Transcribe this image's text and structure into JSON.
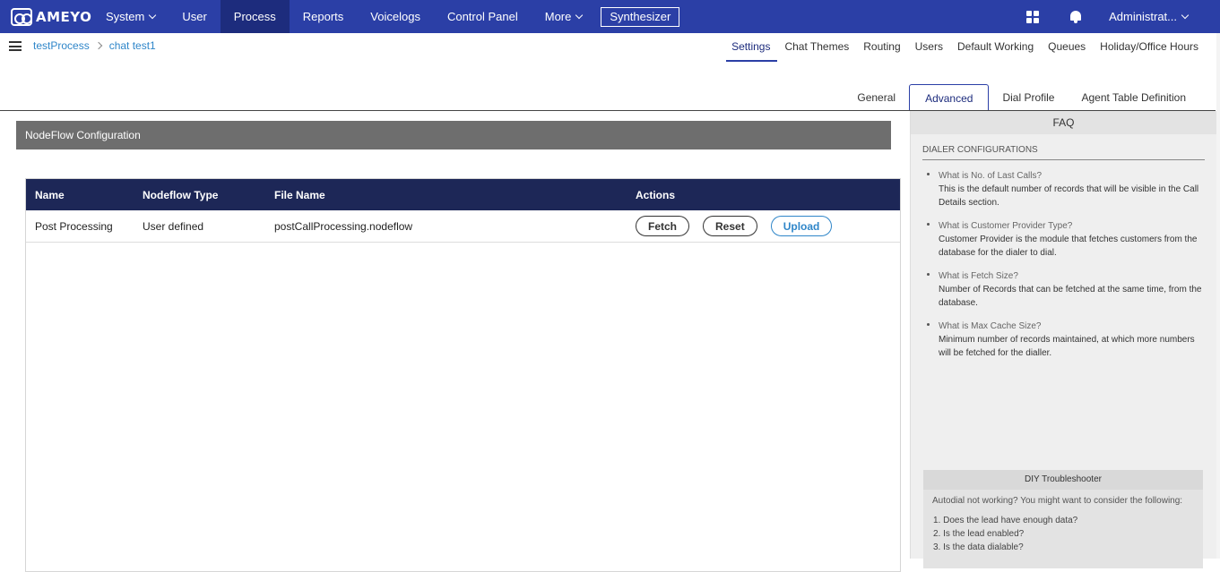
{
  "brand": {
    "name": "AMEYO"
  },
  "nav": {
    "items": [
      {
        "label": "System",
        "has_dropdown": true
      },
      {
        "label": "User"
      },
      {
        "label": "Process",
        "active": true
      },
      {
        "label": "Reports"
      },
      {
        "label": "Voicelogs"
      },
      {
        "label": "Control Panel"
      },
      {
        "label": "More",
        "has_dropdown": true
      }
    ],
    "synthesizer_label": "Synthesizer",
    "admin_label": "Administrat..."
  },
  "breadcrumb": {
    "items": [
      "testProcess",
      "chat test1"
    ]
  },
  "top_tabs": [
    "Settings",
    "Chat Themes",
    "Routing",
    "Users",
    "Default Working",
    "Queues",
    "Holiday/Office Hours"
  ],
  "top_tabs_active": "Settings",
  "sub_tabs": [
    "General",
    "Advanced",
    "Dial Profile",
    "Agent Table Definition"
  ],
  "sub_tabs_active": "Advanced",
  "section": {
    "title": "NodeFlow Configuration"
  },
  "table": {
    "headers": [
      "Name",
      "Nodeflow Type",
      "File Name",
      "Actions"
    ],
    "rows": [
      {
        "name": "Post Processing",
        "type": "User defined",
        "file": "postCallProcessing.nodeflow"
      }
    ],
    "actions": {
      "fetch": "Fetch",
      "reset": "Reset",
      "upload": "Upload"
    }
  },
  "faq": {
    "title": "FAQ",
    "section_heading": "DIALER CONFIGURATIONS",
    "items": [
      {
        "q": "What is No. of Last Calls?",
        "a": "This is the default number of records that will be visible in the Call Details section."
      },
      {
        "q": "What is Customer Provider Type?",
        "a": "Customer Provider is the module that fetches customers from the database for the dialer to dial."
      },
      {
        "q": "What is Fetch Size?",
        "a": "Number of Records that can be fetched at the same time, from the database."
      },
      {
        "q": "What is Max Cache Size?",
        "a": "Minimum number of records maintained, at which more numbers will be fetched for the dialler."
      }
    ]
  },
  "diy": {
    "title": "DIY Troubleshooter",
    "intro": "Autodial not working? You might want to consider the following:",
    "items": [
      "1. Does the lead have enough data?",
      "2. Is the lead enabled?",
      "3. Is the data dialable?"
    ]
  }
}
